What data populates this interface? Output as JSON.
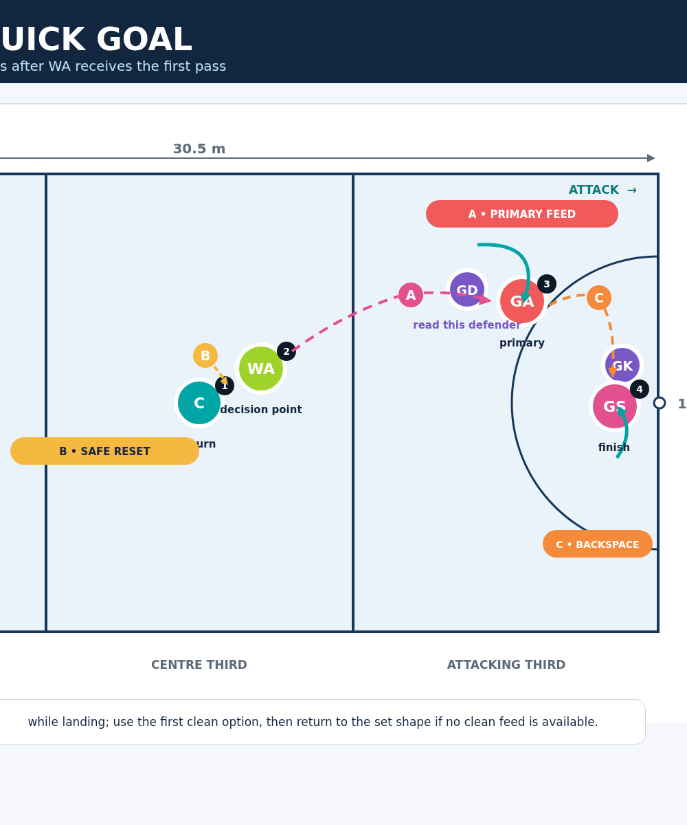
{
  "header": {
    "title": "UICK GOAL",
    "subtitle": "s after WA receives the first pass"
  },
  "court": {
    "dimension_label": "30.5 m",
    "attack_label": "ATTACK  →",
    "goal_label": "1",
    "zones": [
      "CENTRE THIRD",
      "ATTACKING THIRD"
    ],
    "pills": [
      {
        "label": "A • PRIMARY FEED",
        "color": "#f05a5a"
      },
      {
        "label": "B • SAFE RESET",
        "color": "#f5b841"
      },
      {
        "label": "C • BACKSPACE",
        "color": "#f58a3a"
      }
    ],
    "players": [
      {
        "label": "C",
        "color": "#00a5a5"
      },
      {
        "label": "WA",
        "color": "#a0d22c"
      },
      {
        "label": "GD",
        "color": "#7957c4"
      },
      {
        "label": "GA",
        "color": "#f05a5a"
      },
      {
        "label": "GK",
        "color": "#7957c4"
      },
      {
        "label": "GS",
        "color": "#e3508f"
      }
    ],
    "options": [
      {
        "label": "A",
        "color": "#e3508f"
      },
      {
        "label": "B",
        "color": "#f5b841"
      },
      {
        "label": "C",
        "color": "#f58a3a"
      }
    ],
    "steps": [
      "1",
      "2",
      "3",
      "4"
    ],
    "captions": [
      {
        "text": "decision point",
        "kind": "note"
      },
      {
        "text": "urn",
        "kind": "note"
      },
      {
        "text": "read this defender",
        "kind": "defender"
      },
      {
        "text": "primary",
        "kind": "note"
      },
      {
        "text": "finish",
        "kind": "note"
      }
    ]
  },
  "note": "while landing; use the first clean option, then return to the set shape if no clean feed is available."
}
